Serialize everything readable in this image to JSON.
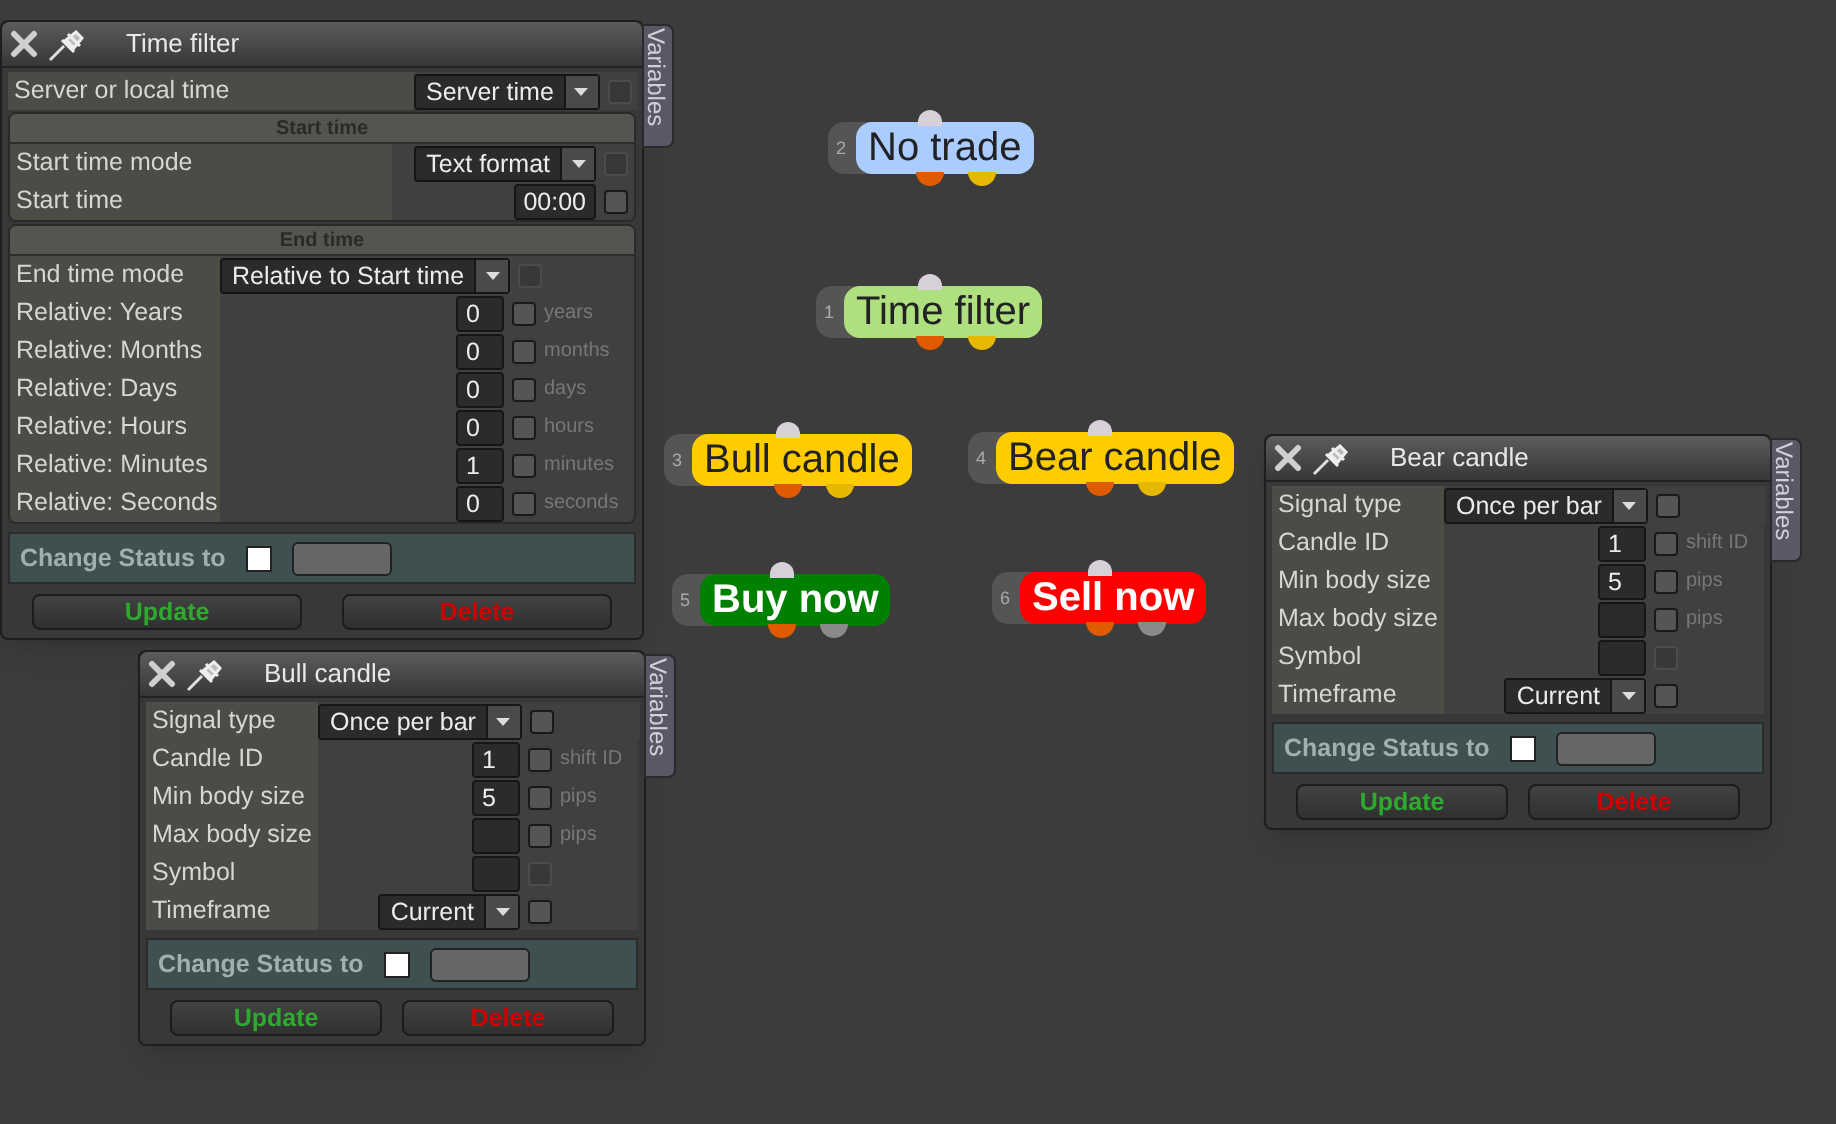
{
  "panels": [
    {
      "title": "Time filter",
      "side_tab": "Variables",
      "sections": [
        {
          "rows": [
            {
              "kind": "select",
              "label": "Server or local time",
              "value": "Server time",
              "checkbox": {
                "checked": false,
                "disabled": true
              }
            }
          ]
        },
        {
          "header": "Start time",
          "rows": [
            {
              "kind": "select",
              "label": "Start time mode",
              "value": "Text format",
              "checkbox": {
                "checked": false,
                "disabled": true
              }
            },
            {
              "kind": "number",
              "label": "Start time",
              "value": "00:00",
              "checkbox": {
                "checked": false,
                "disabled": false
              }
            }
          ]
        },
        {
          "header": "End time",
          "rows": [
            {
              "kind": "select",
              "label": "End time mode",
              "value": "Relative to Start time",
              "checkbox": {
                "checked": false,
                "disabled": true
              }
            },
            {
              "kind": "number",
              "label": "Relative: Years",
              "value": "0",
              "unit": "years",
              "checkbox": {
                "checked": false,
                "disabled": false
              }
            },
            {
              "kind": "number",
              "label": "Relative: Months",
              "value": "0",
              "unit": "months",
              "checkbox": {
                "checked": false,
                "disabled": false
              }
            },
            {
              "kind": "number",
              "label": "Relative: Days",
              "value": "0",
              "unit": "days",
              "checkbox": {
                "checked": false,
                "disabled": false
              }
            },
            {
              "kind": "number",
              "label": "Relative: Hours",
              "value": "0",
              "unit": "hours",
              "checkbox": {
                "checked": false,
                "disabled": false
              }
            },
            {
              "kind": "number",
              "label": "Relative: Minutes",
              "value": "1",
              "unit": "minutes",
              "checkbox": {
                "checked": false,
                "disabled": false
              }
            },
            {
              "kind": "number",
              "label": "Relative: Seconds",
              "value": "0",
              "unit": "seconds",
              "checkbox": {
                "checked": false,
                "disabled": false
              }
            }
          ]
        }
      ],
      "status": {
        "label": "Change Status to",
        "checked": false
      },
      "buttons": [
        {
          "label": "Update",
          "kind": "update"
        },
        {
          "label": "Delete",
          "kind": "delete"
        }
      ]
    },
    {
      "title": "Bear candle",
      "side_tab": "Variables",
      "sections": [
        {
          "rows": [
            {
              "kind": "select",
              "label": "Signal type",
              "value": "Once per bar",
              "checkbox": {
                "checked": false,
                "disabled": false
              }
            },
            {
              "kind": "number",
              "label": "Candle ID",
              "value": "1",
              "unit": "shift ID",
              "checkbox": {
                "checked": false,
                "disabled": false
              }
            },
            {
              "kind": "number",
              "label": "Min body size",
              "value": "5",
              "unit": "pips",
              "checkbox": {
                "checked": false,
                "disabled": false
              }
            },
            {
              "kind": "number",
              "label": "Max body size",
              "unit": "pips",
              "checkbox": {
                "checked": false,
                "disabled": false
              }
            },
            {
              "kind": "number",
              "label": "Symbol",
              "checkbox": {
                "checked": false,
                "disabled": true
              }
            },
            {
              "kind": "select",
              "label": "Timeframe",
              "value": "Current",
              "checkbox": {
                "checked": false,
                "disabled": false
              }
            }
          ]
        }
      ],
      "status": {
        "label": "Change Status to",
        "checked": false
      },
      "buttons": [
        {
          "label": "Update",
          "kind": "update"
        },
        {
          "label": "Delete",
          "kind": "delete"
        }
      ]
    },
    {
      "title": "Bull candle",
      "side_tab": "Variables",
      "sections": [
        {
          "rows": [
            {
              "kind": "select",
              "label": "Signal type",
              "value": "Once per bar",
              "checkbox": {
                "checked": false,
                "disabled": false
              }
            },
            {
              "kind": "number",
              "label": "Candle ID",
              "value": "1",
              "unit": "shift ID",
              "checkbox": {
                "checked": false,
                "disabled": false
              }
            },
            {
              "kind": "number",
              "label": "Min body size",
              "value": "5",
              "unit": "pips",
              "checkbox": {
                "checked": false,
                "disabled": false
              }
            },
            {
              "kind": "number",
              "label": "Max body size",
              "unit": "pips",
              "checkbox": {
                "checked": false,
                "disabled": false
              }
            },
            {
              "kind": "number",
              "label": "Symbol",
              "checkbox": {
                "checked": false,
                "disabled": true
              }
            },
            {
              "kind": "select",
              "label": "Timeframe",
              "value": "Current",
              "checkbox": {
                "checked": false,
                "disabled": false
              }
            }
          ]
        }
      ],
      "status": {
        "label": "Change Status to",
        "checked": false
      },
      "buttons": [
        {
          "label": "Update",
          "kind": "update"
        },
        {
          "label": "Delete",
          "kind": "delete"
        }
      ]
    }
  ],
  "nodes": [
    {
      "number": "2",
      "label": "No trade",
      "color": "#aaccff",
      "children": [
        {
          "number": "1",
          "label": "Time filter",
          "color": "#aee07f",
          "children": [
            {
              "number": "3",
              "label": "Bull candle",
              "color": "#ffcc00",
              "children": [
                {
                  "number": "5",
                  "label": "Buy now",
                  "color": "#008000"
                }
              ]
            },
            {
              "number": "4",
              "label": "Bear candle",
              "color": "#ffcc00",
              "children": [
                {
                  "number": "6",
                  "label": "Sell now",
                  "color": "#ff0000"
                }
              ]
            }
          ]
        }
      ]
    }
  ]
}
